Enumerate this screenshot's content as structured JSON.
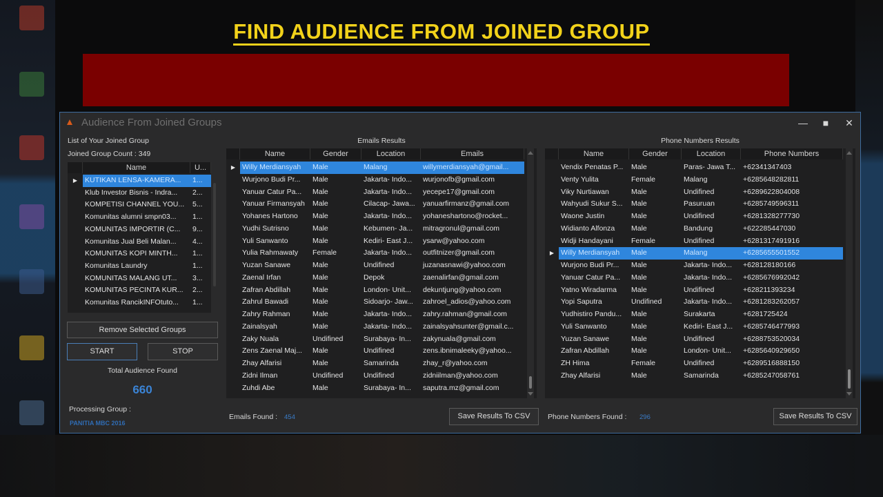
{
  "overlay": {
    "heading": "FIND AUDIENCE FROM JOINED GROUP"
  },
  "window": {
    "title": "Audience From Joined Groups",
    "minimize": "—",
    "maximize": "■",
    "close": "✕"
  },
  "groups": {
    "list_label": "List of Your Joined Group",
    "count_label": "Joined Group Count : 349",
    "columns": [
      "Name",
      "U..."
    ],
    "selected_index": 0,
    "rows": [
      [
        "KUTIKAN LENSA-KAMERA...",
        "1..."
      ],
      [
        "Klub Investor Bisnis - Indra...",
        "2..."
      ],
      [
        "KOMPETISI CHANNEL YOU...",
        "5..."
      ],
      [
        "Komunitas alumni smpn03...",
        "1..."
      ],
      [
        "KOMUNITAS IMPORTIR (C...",
        "9..."
      ],
      [
        "Komunitas Jual Beli Malan...",
        "4..."
      ],
      [
        "KOMUNITAS KOPI MINTH...",
        "1..."
      ],
      [
        "Komunitas Laundry",
        "1..."
      ],
      [
        "KOMUNITAS MALANG UT...",
        "3..."
      ],
      [
        "KOMUNITAS PECINTA KUR...",
        "2..."
      ],
      [
        "Komunitas RancikINFOtuto...",
        "1..."
      ]
    ],
    "remove_button": "Remove Selected Groups",
    "start_button": "START",
    "stop_button": "STOP",
    "total_label": "Total Audience Found",
    "total_value": "660",
    "processing_label": "Processing Group :",
    "processing_value": "PANITIA MBC 2016"
  },
  "emails": {
    "title": "Emails Results",
    "columns": [
      "Name",
      "Gender",
      "Location",
      "Emails"
    ],
    "selected_index": 0,
    "rows": [
      [
        "Willy Merdiansyah",
        "Male",
        "Malang",
        "willymerdiansyah@gmail..."
      ],
      [
        "Wurjono Budi Pr...",
        "Male",
        "Jakarta- Indo...",
        "wurjonofb@gmail.com"
      ],
      [
        "Yanuar Catur Pa...",
        "Male",
        "Jakarta- Indo...",
        "yecepe17@gmail.com"
      ],
      [
        "Yanuar Firmansyah",
        "Male",
        "Cilacap- Jawa...",
        "yanuarfirmanz@gmail.com"
      ],
      [
        "Yohanes Hartono",
        "Male",
        "Jakarta- Indo...",
        "yohaneshartono@rocket..."
      ],
      [
        "Yudhi Sutrisno",
        "Male",
        "Kebumen- Ja...",
        "mitragronul@gmail.com"
      ],
      [
        "Yuli Sanwanto",
        "Male",
        "Kediri- East J...",
        "ysarw@yahoo.com"
      ],
      [
        "Yulia Rahmawaty",
        "Female",
        "Jakarta- Indo...",
        "outfitnizer@gmail.com"
      ],
      [
        "Yuzan Sanawe",
        "Male",
        "Undifined",
        "juzanasnawi@yahoo.com"
      ],
      [
        "Zaenal Irfan",
        "Male",
        "Depok",
        "zaenalirfan@gmail.com"
      ],
      [
        "Zafran Abdillah",
        "Male",
        "London- Unit...",
        "dekuntjung@yahoo.com"
      ],
      [
        "Zahrul Bawadi",
        "Male",
        "Sidoarjo- Jaw...",
        "zahroel_adios@yahoo.com"
      ],
      [
        "Zahry Rahman",
        "Male",
        "Jakarta- Indo...",
        "zahry.rahman@gmail.com"
      ],
      [
        "Zainalsyah",
        "Male",
        "Jakarta- Indo...",
        "zainalsyahsunter@gmail.c..."
      ],
      [
        "Zaky Nuala",
        "Undifined",
        "Surabaya- In...",
        "zakynuala@gmail.com"
      ],
      [
        "Zens Zaenal Maj...",
        "Male",
        "Undifined",
        "zens.ibnimaleeky@yahoo..."
      ],
      [
        "Zhay Alfarisi",
        "Male",
        "Samarinda",
        "zhay_r@yahoo.com"
      ],
      [
        "Zidni Ilman",
        "Undifined",
        "Undifined",
        "zidniilman@yahoo.com"
      ],
      [
        "Zuhdi Abe",
        "Male",
        "Surabaya- In...",
        "saputra.mz@gmail.com"
      ]
    ],
    "found_label": "Emails Found :",
    "found_value": "454",
    "save_button": "Save Results To CSV"
  },
  "phones": {
    "title": "Phone Numbers Results",
    "columns": [
      "Name",
      "Gender",
      "Location",
      "Phone Numbers"
    ],
    "selected_index": 7,
    "rows": [
      [
        "Vendix Penatas P...",
        "Male",
        "Paras- Jawa T...",
        "+62341347403"
      ],
      [
        "Venty Yulita",
        "Female",
        "Malang",
        "+6285648282811"
      ],
      [
        "Viky Nurtiawan",
        "Male",
        "Undifined",
        "+6289622804008"
      ],
      [
        "Wahyudi Sukur S...",
        "Male",
        "Pasuruan",
        "+6285749596311"
      ],
      [
        "Waone Justin",
        "Male",
        "Undifined",
        "+6281328277730"
      ],
      [
        "Widianto Alfonza",
        "Male",
        "Bandung",
        "+622285447030"
      ],
      [
        "Widji Handayani",
        "Female",
        "Undifined",
        "+6281317491916"
      ],
      [
        "Willy Merdiansyah",
        "Male",
        "Malang",
        "+6285655501552"
      ],
      [
        "Wurjono Budi Pr...",
        "Male",
        "Jakarta- Indo...",
        "+628128180166"
      ],
      [
        "Yanuar Catur Pa...",
        "Male",
        "Jakarta- Indo...",
        "+6285676992042"
      ],
      [
        "Yatno Wiradarma",
        "Male",
        "Undifined",
        "+628211393234"
      ],
      [
        "Yopi Saputra",
        "Undifined",
        "Jakarta- Indo...",
        "+6281283262057"
      ],
      [
        "Yudhistiro Pandu...",
        "Male",
        "Surakarta",
        "+6281725424"
      ],
      [
        "Yuli Sanwanto",
        "Male",
        "Kediri- East J...",
        "+6285746477993"
      ],
      [
        "Yuzan Sanawe",
        "Male",
        "Undifined",
        "+6288753520034"
      ],
      [
        "Zafran Abdillah",
        "Male",
        "London- Unit...",
        "+6285640929650"
      ],
      [
        "ZH Hima",
        "Female",
        "Undifined",
        "+6289516888150"
      ],
      [
        "Zhay Alfarisi",
        "Male",
        "Samarinda",
        "+6285247058761"
      ]
    ],
    "found_label": "Phone Numbers Found :",
    "found_value": "296",
    "save_button": "Save Results To CSV"
  }
}
